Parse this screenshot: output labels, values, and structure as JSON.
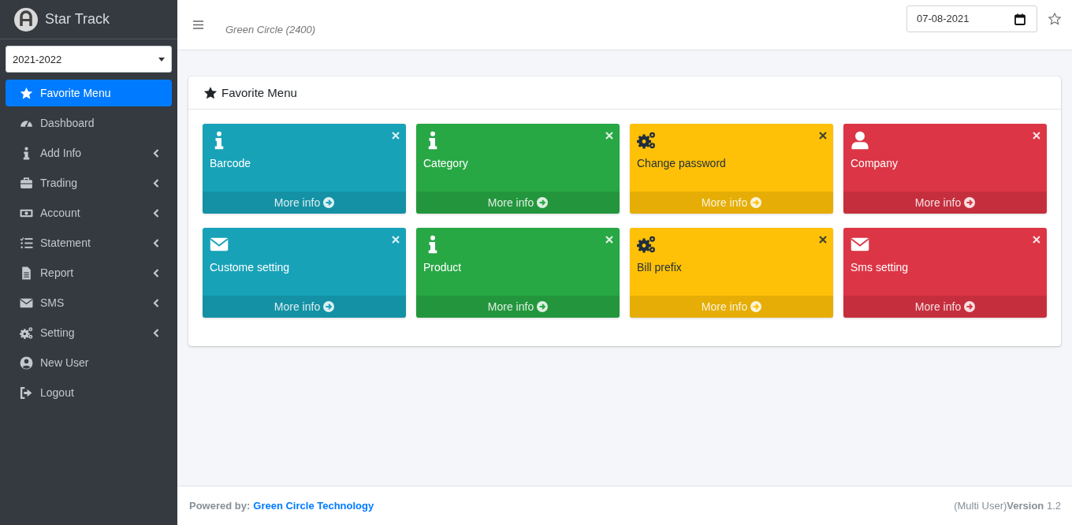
{
  "brand": {
    "name": "Star Track"
  },
  "year_select": {
    "value": "2021-2022"
  },
  "sidebar": {
    "items": [
      {
        "label": "Favorite Menu",
        "kind": "star",
        "has_submenu": false,
        "selected": true
      },
      {
        "label": "Dashboard",
        "kind": "gauge",
        "has_submenu": false,
        "selected": false
      },
      {
        "label": "Add Info",
        "kind": "info",
        "has_submenu": true,
        "selected": false
      },
      {
        "label": "Trading",
        "kind": "briefcase",
        "has_submenu": true,
        "selected": false
      },
      {
        "label": "Account",
        "kind": "money",
        "has_submenu": true,
        "selected": false
      },
      {
        "label": "Statement",
        "kind": "list",
        "has_submenu": true,
        "selected": false
      },
      {
        "label": "Report",
        "kind": "file",
        "has_submenu": true,
        "selected": false
      },
      {
        "label": "SMS",
        "kind": "envelope",
        "has_submenu": true,
        "selected": false
      },
      {
        "label": "Setting",
        "kind": "gears",
        "has_submenu": true,
        "selected": false
      },
      {
        "label": "New User",
        "kind": "usercircle",
        "has_submenu": false,
        "selected": false
      },
      {
        "label": "Logout",
        "kind": "signout",
        "has_submenu": false,
        "selected": false
      }
    ]
  },
  "header": {
    "company": "Green Circle (2400)",
    "date": "07-08-2021"
  },
  "favorite_card": {
    "title": "Favorite Menu",
    "tiles": [
      {
        "label": "Barcode",
        "kind": "info",
        "color": "#17a2b8",
        "link": "More info"
      },
      {
        "label": "Category",
        "kind": "info",
        "color": "#28a745",
        "link": "More info"
      },
      {
        "label": "Change password",
        "kind": "gears",
        "color": "#ffc107",
        "link": "More info"
      },
      {
        "label": "Company",
        "kind": "user",
        "color": "#dc3545",
        "link": "More info"
      },
      {
        "label": "Custome setting",
        "kind": "envelope",
        "color": "#17a2b8",
        "link": "More info"
      },
      {
        "label": "Product",
        "kind": "info",
        "color": "#28a745",
        "link": "More info"
      },
      {
        "label": "Bill prefix",
        "kind": "gears",
        "color": "#ffc107",
        "link": "More info"
      },
      {
        "label": "Sms setting",
        "kind": "envelope",
        "color": "#dc3545",
        "link": "More info"
      }
    ]
  },
  "footer": {
    "powered_label": "Powered by:",
    "powered_link": "Green Circle Technology",
    "version": "(Multi User)**Version** 1.2"
  }
}
